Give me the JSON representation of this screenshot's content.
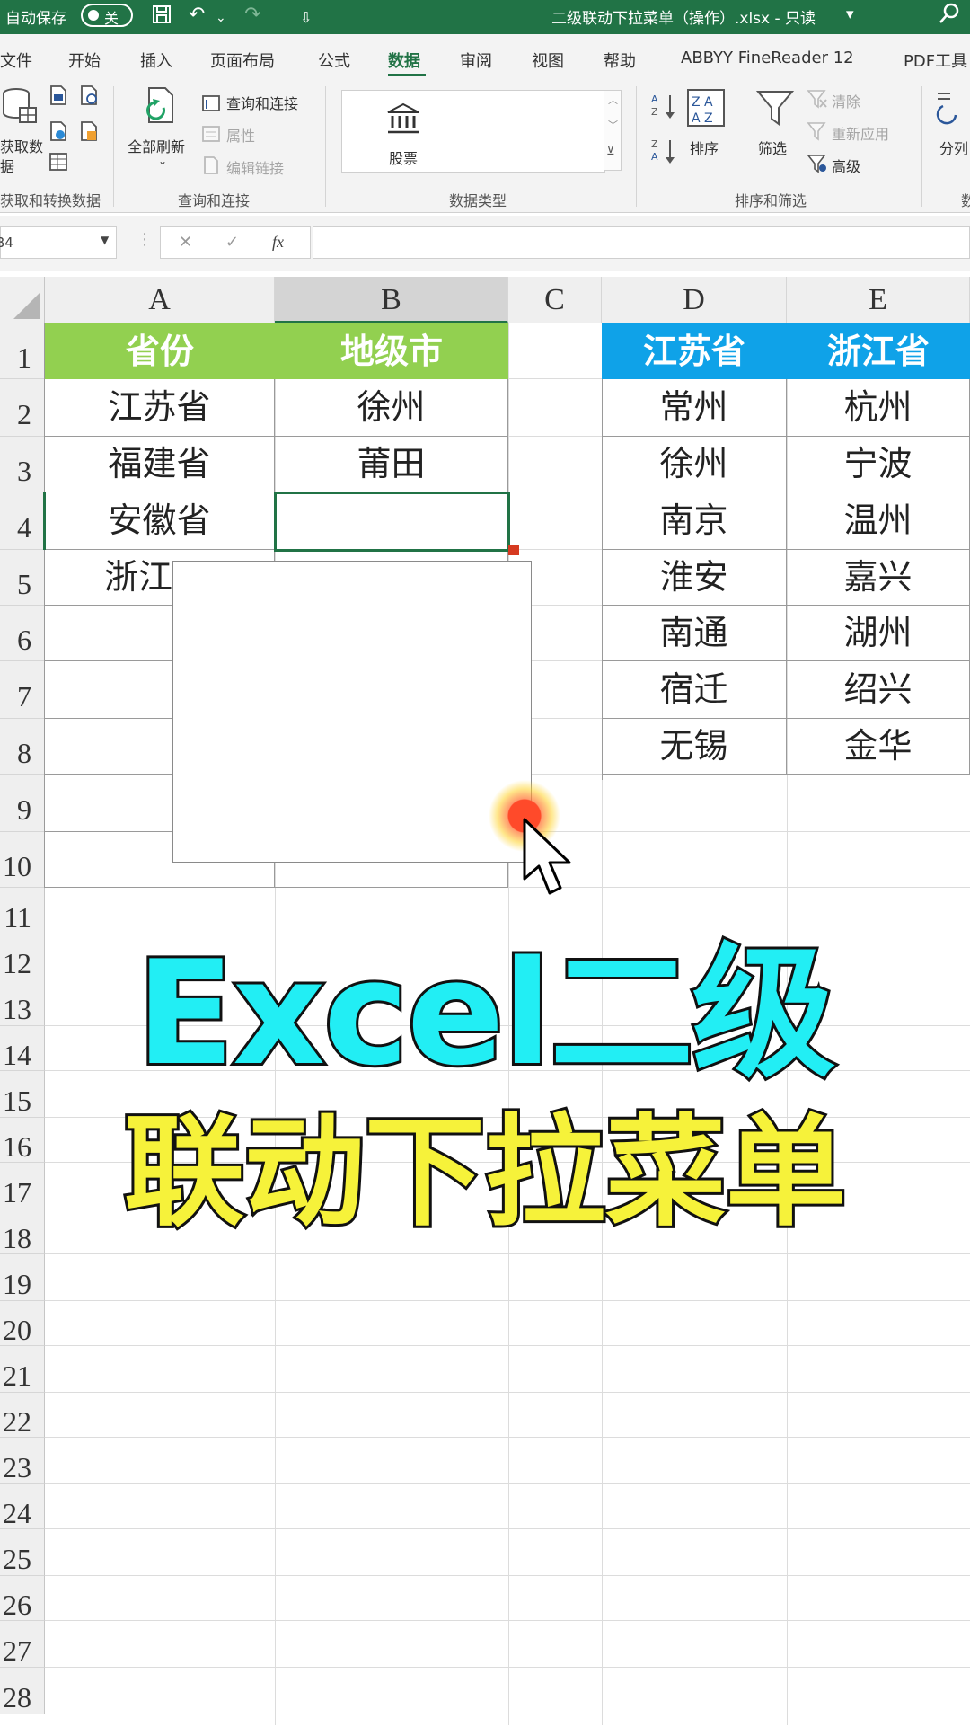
{
  "titlebar": {
    "autosave_label": "自动保存",
    "autosave_state": "关",
    "title": "二级联动下拉菜单（操作）.xlsx  -  只读",
    "title_arrow": "▾",
    "save_icon": "💾",
    "undo_icon": "↶",
    "redo_icon": "↷",
    "qat_icon": "⇩",
    "search_icon": "⚲"
  },
  "menu": {
    "tabs": [
      "文件",
      "开始",
      "插入",
      "页面布局",
      "公式",
      "数据",
      "审阅",
      "视图",
      "帮助",
      "ABBYY FineReader 12",
      "PDF工具"
    ],
    "active": "数据"
  },
  "ribbon": {
    "get_data_label_1": "获取数",
    "get_data_label_2": "据",
    "group_get": "获取和转换数据",
    "refresh_all": "全部刷新",
    "queries_connections": "查询和连接",
    "properties": "属性",
    "edit_links": "编辑链接",
    "group_queries": "查询和连接",
    "stocks": "股票",
    "group_datatypes": "数据类型",
    "sort": "排序",
    "filter": "筛选",
    "clear": "清除",
    "reapply": "重新应用",
    "advanced": "高级",
    "group_sortfilter": "排序和筛选",
    "split": "分列",
    "split_group": "数"
  },
  "formula": {
    "name_box": "B4",
    "cancel": "✕",
    "enter": "✓",
    "fx": "fx",
    "content": ""
  },
  "sheet": {
    "columns": [
      "A",
      "B",
      "C",
      "D",
      "E"
    ],
    "selected_column": "B",
    "rows": [
      "1",
      "2",
      "3",
      "4",
      "5",
      "6",
      "7",
      "8",
      "9",
      "10",
      "11",
      "12",
      "13",
      "14",
      "15",
      "16",
      "17",
      "18",
      "19",
      "20",
      "21",
      "22",
      "23",
      "24",
      "25",
      "26",
      "27",
      "28"
    ],
    "selected_cell": "B4",
    "header_province": "省份",
    "header_city": "地级市",
    "provinces": [
      "江苏省",
      "福建省",
      "安徽省",
      "浙江"
    ],
    "cities": [
      "徐州",
      "莆田",
      ""
    ],
    "header_jiangsu": "江苏省",
    "header_zhejiang": "浙江省",
    "jiangsu_cities": [
      "常州",
      "徐州",
      "南京",
      "淮安",
      "南通",
      "宿迁",
      "无锡"
    ],
    "zhejiang_cities": [
      "杭州",
      "宁波",
      "温州",
      "嘉兴",
      "湖州",
      "绍兴",
      "金华"
    ],
    "header_green": "#92d050",
    "header_blue": "#0fa2e8"
  },
  "overlay": {
    "line1": "Excel二级",
    "line2": "联动下拉菜单",
    "line1_color": "#22eef4",
    "line2_color": "#f6f23a"
  },
  "cursor": "pointer-arrow-icon"
}
